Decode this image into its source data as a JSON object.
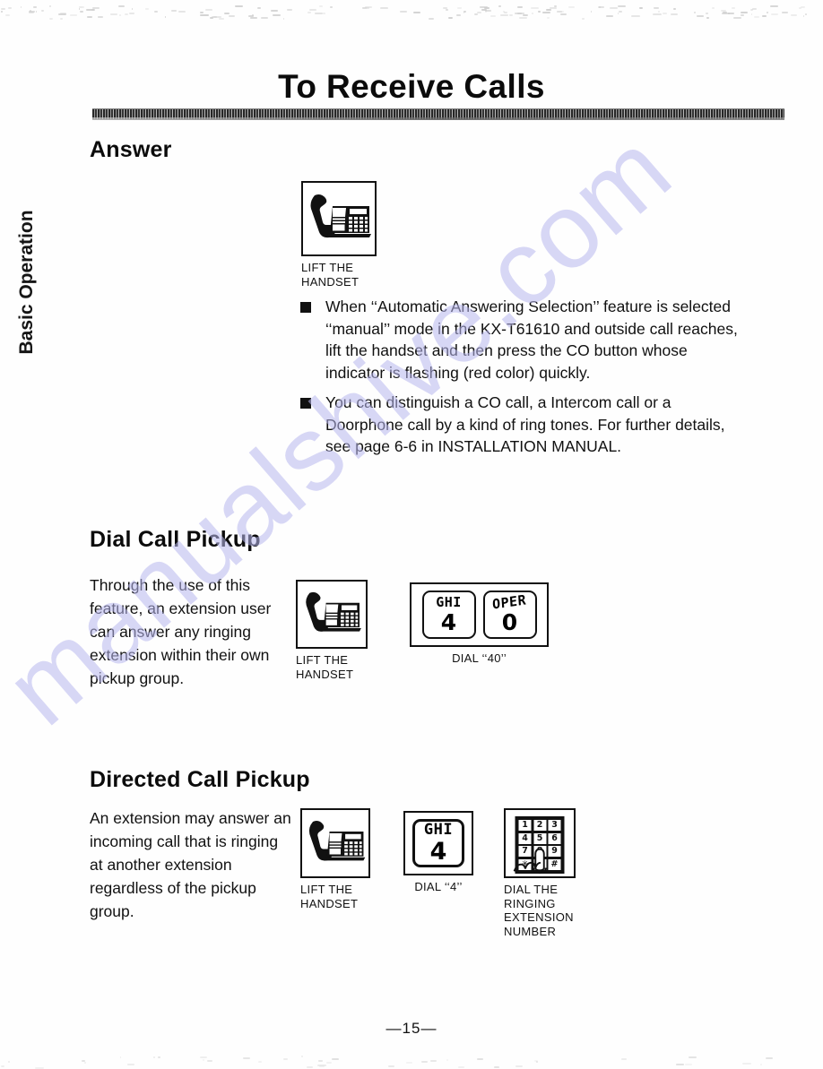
{
  "page": {
    "title": "To Receive Calls",
    "side_tab": "Basic Operation",
    "page_number": "—15—",
    "watermark": "manualshive.com"
  },
  "sections": [
    {
      "heading": "Answer",
      "figure": {
        "icon": "desk-phone-handset-lifted",
        "caption_line1": "LIFT THE",
        "caption_line2": "HANDSET"
      },
      "bullets": [
        "When ‘‘Automatic Answering Selection’’ feature is selected ‘‘manual’’ mode in the KX-T61610 and outside call reaches, lift the handset and then press the CO button whose indicator is flashing (red color) quickly.",
        "You can distinguish a CO call, a Intercom call or a Doorphone call by a kind of ring tones. For further details, see page 6-6 in INSTALLATION MANUAL."
      ]
    },
    {
      "heading": "Dial Call Pickup",
      "body": "Through the use of this feature, an extension user can answer any ringing extension within their own pickup group.",
      "figures": [
        {
          "icon": "desk-phone-handset-lifted",
          "caption_line1": "LIFT THE",
          "caption_line2": "HANDSET"
        },
        {
          "icon": "keypad-keys",
          "keys": [
            {
              "letters": "GHI",
              "digit": "4"
            },
            {
              "letters": "OPER",
              "digit": "0"
            }
          ],
          "caption_line1": "DIAL ‘‘40’’",
          "caption_line2": ""
        }
      ]
    },
    {
      "heading": "Directed Call Pickup",
      "body": "An extension may answer an incoming call that is ringing at another extension regardless of the pickup group.",
      "figures": [
        {
          "icon": "desk-phone-handset-lifted",
          "caption_line1": "LIFT THE",
          "caption_line2": "HANDSET"
        },
        {
          "icon": "keypad-key-single",
          "keys": [
            {
              "letters": "GHI",
              "digit": "4"
            }
          ],
          "caption_line1": "DIAL ‘‘4’’",
          "caption_line2": ""
        },
        {
          "icon": "dialpad-with-finger",
          "pad_keys": [
            "1",
            "2",
            "3",
            "4",
            "5",
            "6",
            "7",
            "8",
            "9",
            "✳",
            "0",
            "#"
          ],
          "caption_line1": "DIAL THE",
          "caption_line2": "RINGING",
          "caption_line3": "EXTENSION",
          "caption_line4": "NUMBER"
        }
      ]
    }
  ],
  "colors": {
    "ink": "#111111",
    "watermark": "#b9b8ef",
    "paper": "#fefefe"
  }
}
